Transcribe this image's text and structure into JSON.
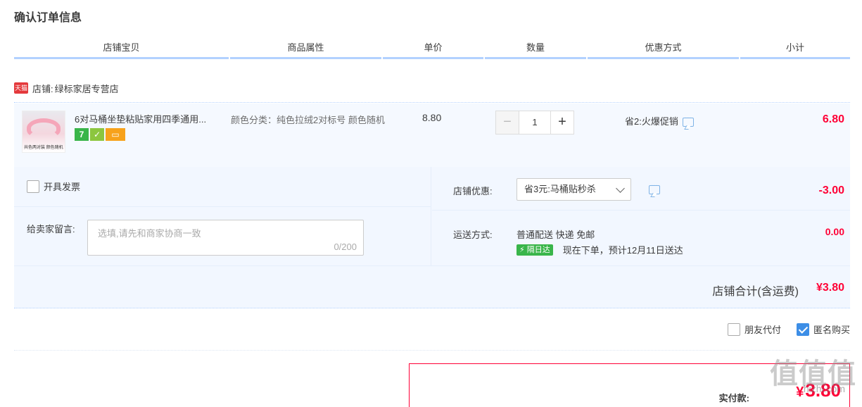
{
  "page": {
    "title": "确认订单信息"
  },
  "columns": [
    "店铺宝贝",
    "商品属性",
    "单价",
    "数量",
    "优惠方式",
    "小计"
  ],
  "shop": {
    "badge": "天猫",
    "label": "店铺:",
    "name": "绿标家居专营店"
  },
  "item": {
    "thumb_caption": "共色两对装 颜色随机",
    "title": "6对马桶坐垫粘贴家用四季通用...",
    "attributes": "颜色分类：纯色拉绒2对标号 颜色随机",
    "unit_price": "8.80",
    "quantity": "1",
    "qty_minus": "−",
    "qty_plus": "+",
    "promotion": "省2:火爆促销",
    "subtotal": "6.80",
    "badges": [
      {
        "icon": "seven-days-return-icon",
        "text": "7"
      },
      {
        "icon": "shop-guarantee-icon",
        "text": ""
      },
      {
        "icon": "card-payment-icon",
        "text": ""
      }
    ]
  },
  "invoice": {
    "label": "开具发票"
  },
  "message": {
    "label": "给卖家留言:",
    "placeholder": "选填,请先和商家协商一致",
    "counter": "0/200"
  },
  "shop_discount": {
    "label": "店铺优惠:",
    "selected": "省3元:马桶贴秒杀",
    "amount": "-3.00"
  },
  "shipping": {
    "label": "运送方式:",
    "method": "普通配送 快递 免邮",
    "badge": "隔日达",
    "eta": "现在下单，预计12月11日送达",
    "amount": "0.00"
  },
  "shop_total": {
    "label": "店铺合计(含运费)",
    "amount": "¥3.80"
  },
  "options": {
    "friend_pay": "朋友代付",
    "anonymous": "匿名购买"
  },
  "payment": {
    "label": "实付款:",
    "currency": "¥",
    "amount": "3.80"
  },
  "watermark": {
    "text": "值值值",
    "sub": "hizhi.com"
  },
  "colors": {
    "accent": "#ff0036",
    "header_underline": "#b2d1ff",
    "panel_bg": "#f2f7ff",
    "checkbox_checked": "#3d8ee6"
  }
}
